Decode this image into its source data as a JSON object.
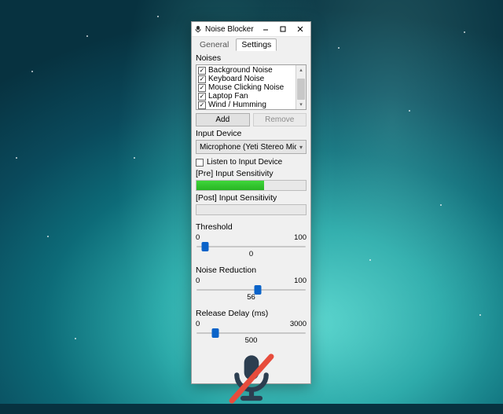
{
  "window": {
    "title": "Noise Blocker"
  },
  "tabs": {
    "general": "General",
    "settings": "Settings",
    "active": "settings"
  },
  "noises": {
    "label": "Noises",
    "items": [
      {
        "label": "Background Noise",
        "checked": true
      },
      {
        "label": "Keyboard Noise",
        "checked": true
      },
      {
        "label": "Mouse Clicking Noise",
        "checked": true
      },
      {
        "label": "Laptop Fan",
        "checked": true
      },
      {
        "label": "Wind / Humming",
        "checked": true
      }
    ],
    "add": "Add",
    "remove": "Remove"
  },
  "inputDevice": {
    "label": "Input Device",
    "selected": "Microphone (Yeti Stereo Microph",
    "listen": "Listen to Input Device",
    "listenChecked": false
  },
  "sensitivity": {
    "preLabel": "[Pre] Input Sensitivity",
    "preFillPercent": 62,
    "postLabel": "[Post] Input Sensitivity",
    "postFillPercent": 0
  },
  "sliders": {
    "threshold": {
      "label": "Threshold",
      "min": "0",
      "max": "100",
      "value": "0",
      "percent": 8
    },
    "noiseReduction": {
      "label": "Noise Reduction",
      "min": "0",
      "max": "100",
      "value": "56",
      "percent": 56
    },
    "releaseDelay": {
      "label": "Release Delay (ms)",
      "min": "0",
      "max": "3000",
      "value": "500",
      "percent": 17
    }
  },
  "statusIcon": "mic-muted-icon"
}
